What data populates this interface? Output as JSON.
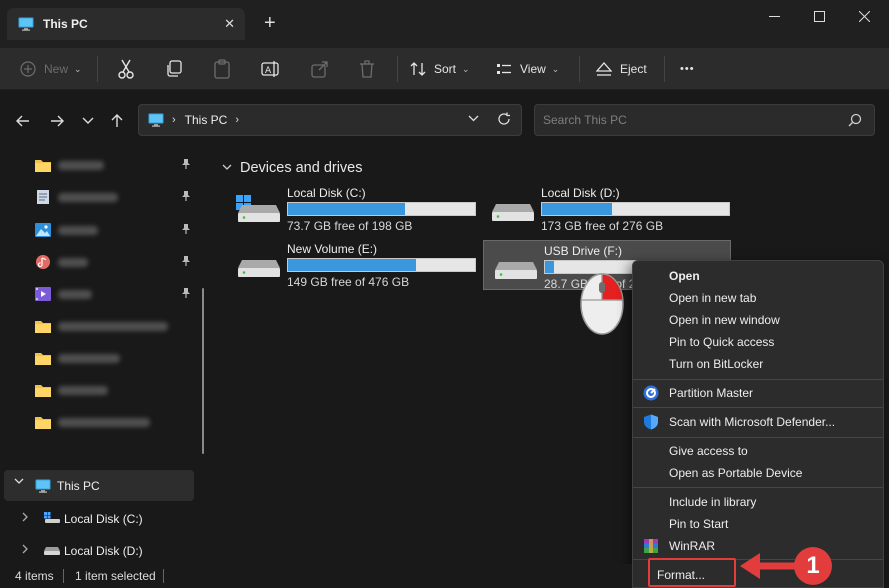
{
  "window": {
    "tab_title": "This PC",
    "new_tab_symbol": "+",
    "close_tab_symbol": "✕"
  },
  "toolbar": {
    "new_label": "New",
    "sort_label": "Sort",
    "view_label": "View",
    "eject_label": "Eject",
    "more_symbol": "•••"
  },
  "address": {
    "crumb": "This PC",
    "search_placeholder": "Search This PC"
  },
  "sidebar": {
    "this_pc_label": "This PC",
    "children": [
      {
        "label": "Local Disk (C:)"
      },
      {
        "label": "Local Disk (D:)"
      }
    ]
  },
  "main": {
    "group_title": "Devices and drives",
    "drives": [
      {
        "name": "Local Disk (C:)",
        "free_text": "73.7 GB free of 198 GB",
        "used_fraction": 0.628
      },
      {
        "name": "Local Disk (D:)",
        "free_text": "173 GB free of 276 GB",
        "used_fraction": 0.373
      },
      {
        "name": "New Volume (E:)",
        "free_text": "149 GB free of 476 GB",
        "used_fraction": 0.687
      },
      {
        "name": "USB Drive (F:)",
        "free_text": "28.7 GB free of 28.",
        "used_fraction": 0.05
      }
    ]
  },
  "context_menu": {
    "items": {
      "open": "Open",
      "open_new_tab": "Open in new tab",
      "open_new_window": "Open in new window",
      "pin_quick": "Pin to Quick access",
      "bitlocker": "Turn on BitLocker",
      "partition_master": "Partition Master",
      "defender": "Scan with Microsoft Defender...",
      "give_access": "Give access to",
      "portable": "Open as Portable Device",
      "include_library": "Include in library",
      "pin_start": "Pin to Start",
      "winrar": "WinRAR",
      "format": "Format..."
    }
  },
  "annotation": {
    "step_number": "1",
    "color": "#e23c3c"
  },
  "status": {
    "items_count": "4 items",
    "selected": "1 item selected"
  },
  "colors": {
    "accent": "#3a96dd",
    "background": "#191919",
    "menu_bg": "#2c2c2c"
  }
}
